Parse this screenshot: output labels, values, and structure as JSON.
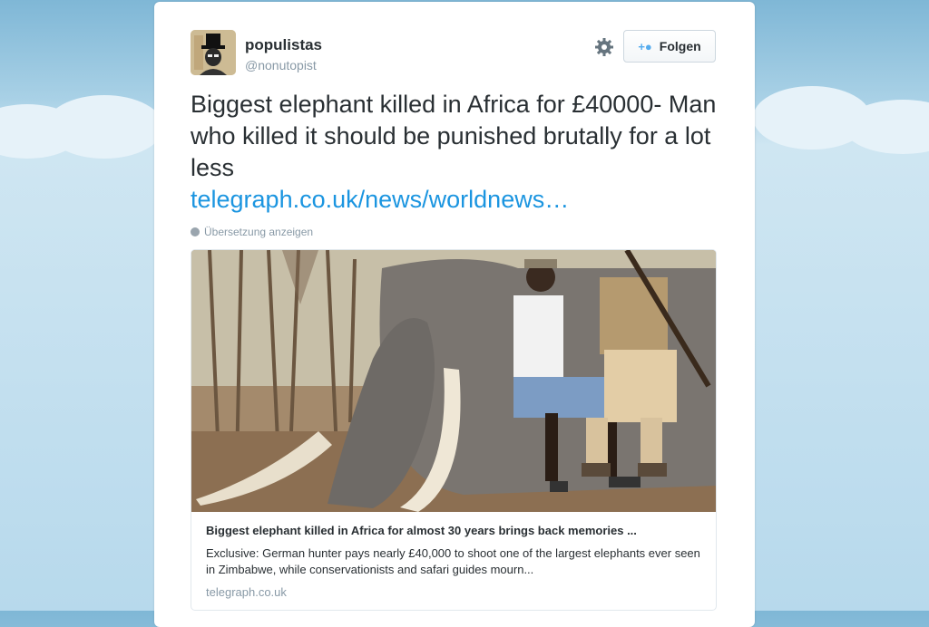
{
  "user": {
    "name": "populistas",
    "handle": "@nonutopist"
  },
  "follow_label": "Folgen",
  "tweet": {
    "text": "Biggest elephant killed in Africa for £40000- Man who killed it should be punished brutally for a lot less",
    "link": "telegraph.co.uk/news/worldnews…",
    "translate_label": "Übersetzung anzeigen"
  },
  "card": {
    "title": "Biggest elephant killed in Africa for almost 30 years brings back memories ...",
    "description": "Exclusive: German hunter pays nearly £40,000 to shoot one of the largest elephants ever seen in Zimbabwe, while conservationists and safari guides mourn...",
    "domain": "telegraph.co.uk"
  },
  "colors": {
    "link": "#1b95e0",
    "text": "#292f33",
    "muted": "#8899a6",
    "accent": "#55acee"
  },
  "icons": [
    "gear-icon",
    "add-user-icon",
    "globe-icon"
  ]
}
